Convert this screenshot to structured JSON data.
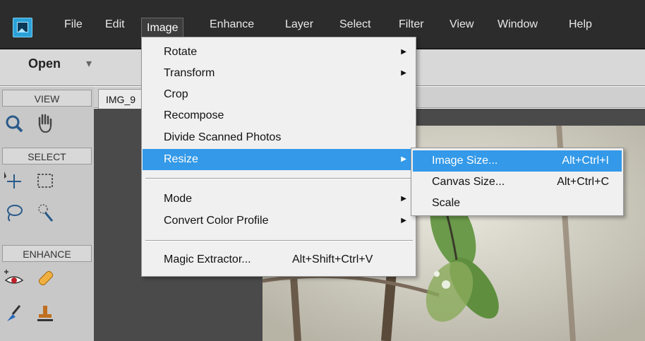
{
  "menubar": {
    "items": [
      "File",
      "Edit",
      "Image",
      "Enhance",
      "Layer",
      "Select",
      "Filter",
      "View",
      "Window",
      "Help"
    ],
    "active": "Image"
  },
  "toolbar": {
    "open_label": "Open",
    "open_caret": "▾"
  },
  "panel": {
    "view_label": "VIEW",
    "select_label": "SELECT",
    "enhance_label": "ENHANCE",
    "tools": [
      "zoom-tool",
      "hand-tool",
      "move-tool",
      "marquee-tool",
      "lasso-tool",
      "quick-selection-tool",
      "red-eye-tool",
      "spot-healing-tool",
      "smart-brush-tool",
      "clone-stamp-tool"
    ]
  },
  "document": {
    "tab_label": "IMG_9"
  },
  "image_menu": {
    "items": [
      {
        "label": "Rotate",
        "submenu": true
      },
      {
        "label": "Transform",
        "submenu": true
      },
      {
        "label": "Crop",
        "submenu": false
      },
      {
        "label": "Recompose",
        "submenu": false
      },
      {
        "label": "Divide Scanned Photos",
        "submenu": false
      },
      {
        "label": "Resize",
        "submenu": true,
        "highlighted": true
      },
      {
        "label": "Mode",
        "submenu": true
      },
      {
        "label": "Convert Color Profile",
        "submenu": true
      },
      {
        "label": "Magic Extractor...",
        "shortcut": "Alt+Shift+Ctrl+V"
      }
    ]
  },
  "resize_submenu": {
    "items": [
      {
        "label": "Image Size...",
        "shortcut": "Alt+Ctrl+I",
        "highlighted": true
      },
      {
        "label": "Canvas Size...",
        "shortcut": "Alt+Ctrl+C"
      },
      {
        "label": "Scale",
        "shortcut": ""
      }
    ]
  },
  "colors": {
    "menubar_bg": "#2c2c2c",
    "highlight": "#3399e8",
    "menu_bg": "#f0f0f0",
    "accent_icon": "#2aa1d8"
  }
}
